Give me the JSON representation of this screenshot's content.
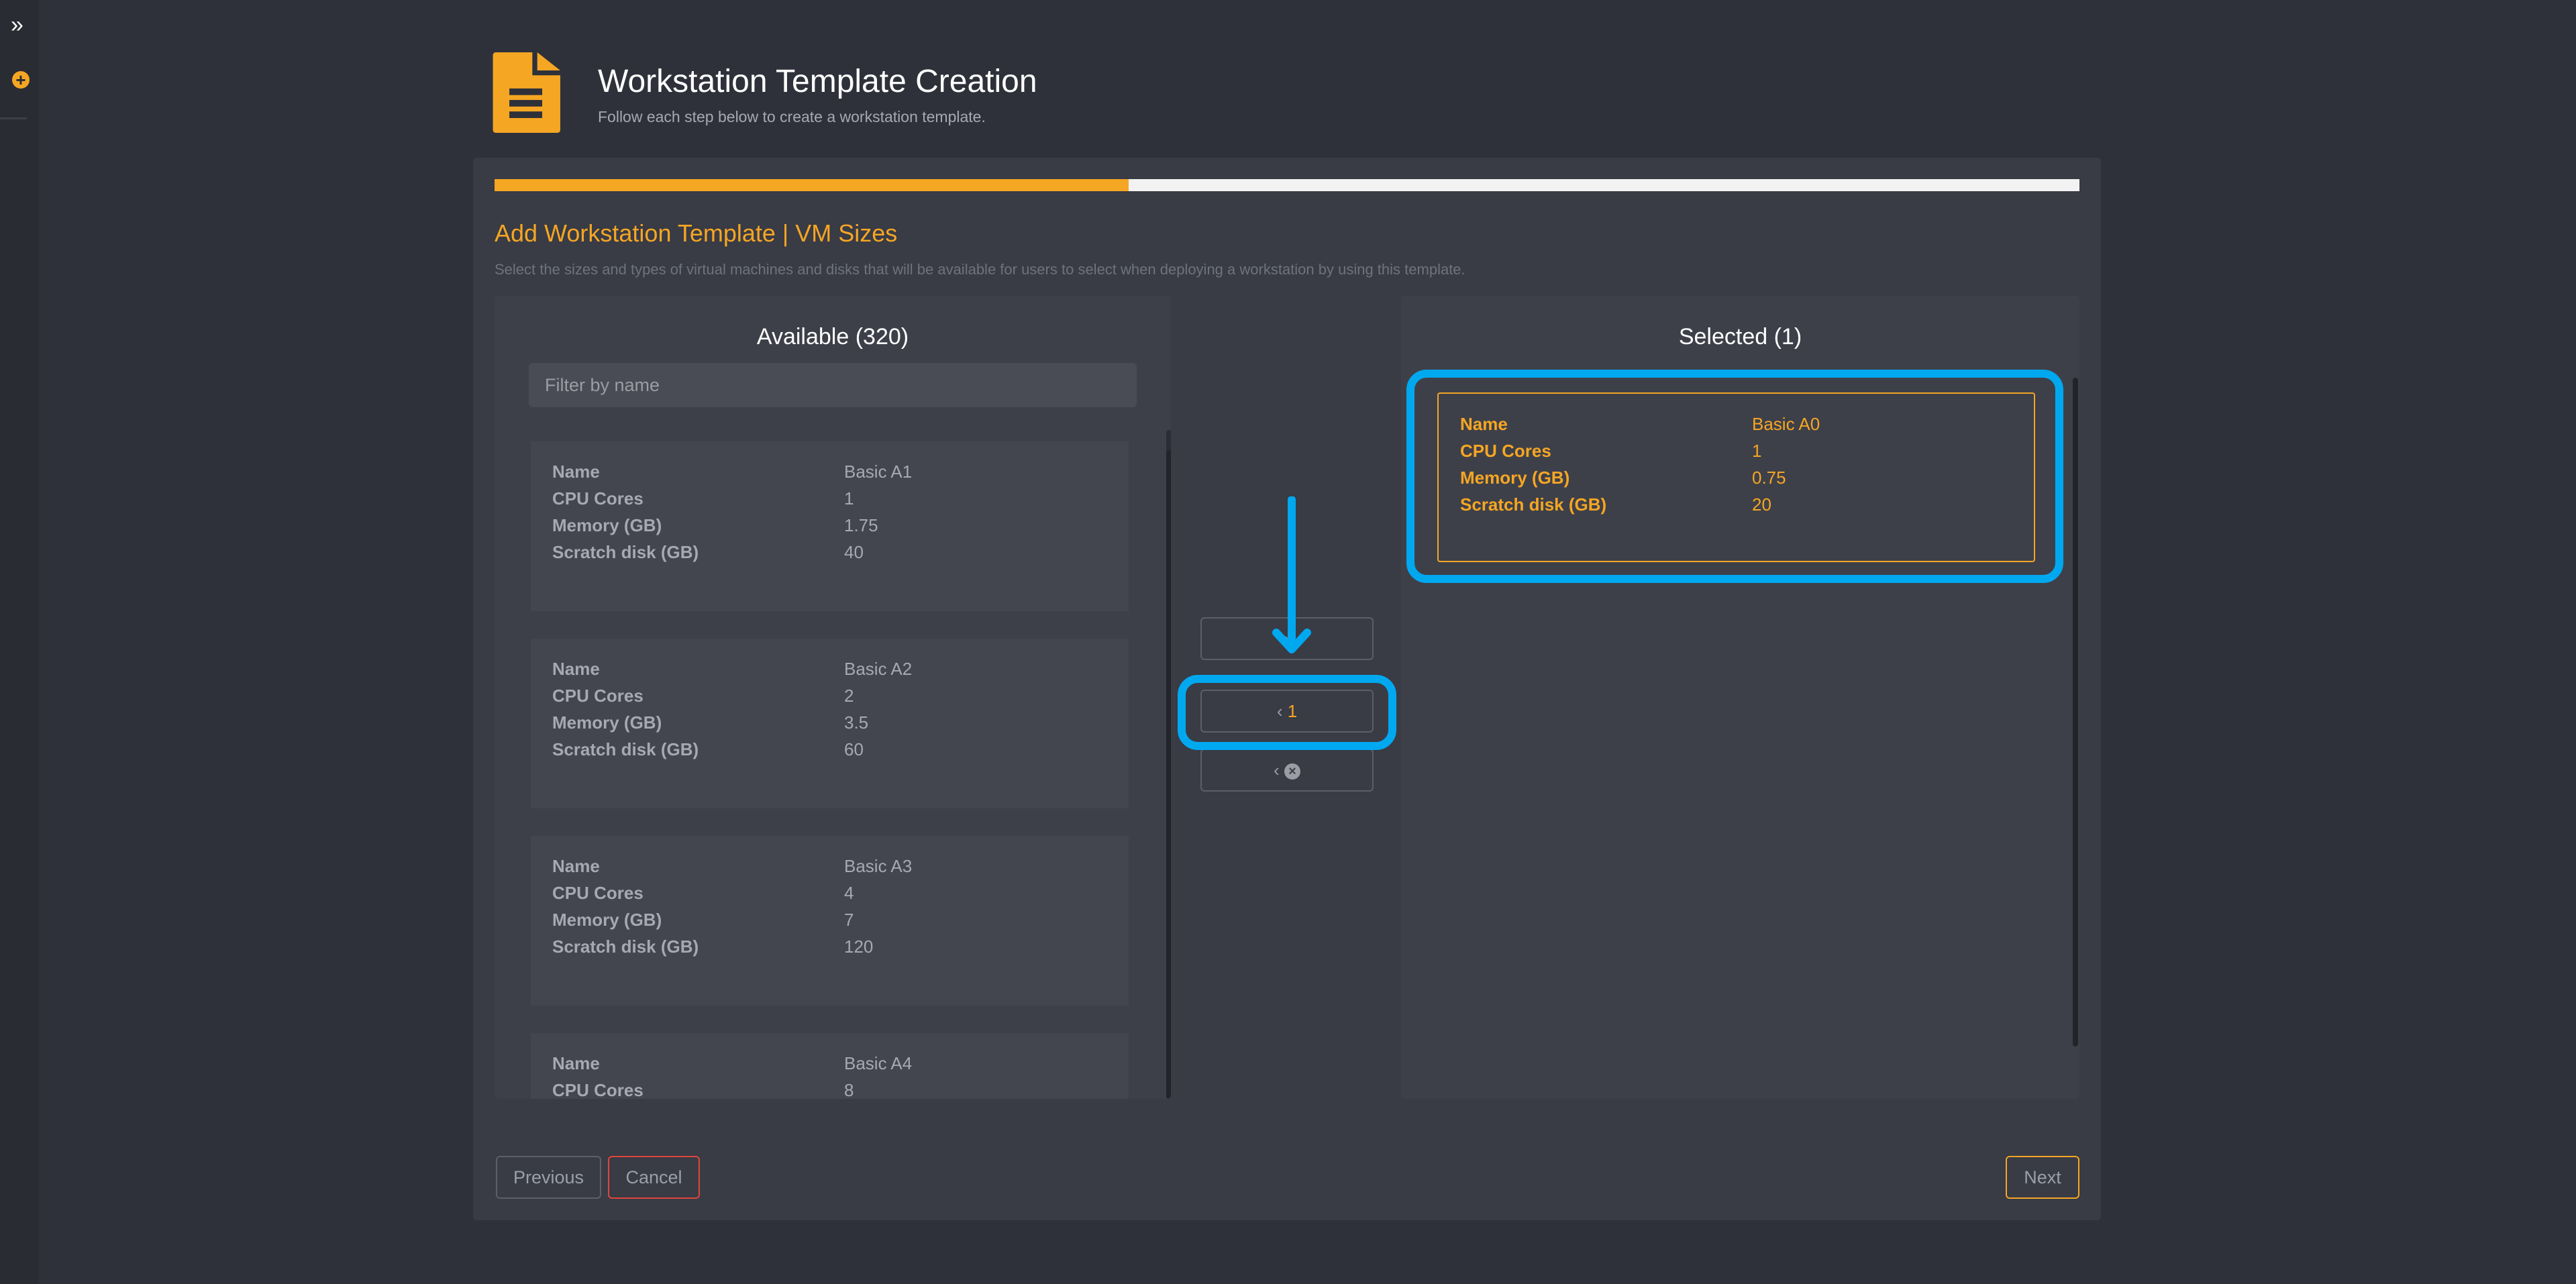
{
  "sidebar": {
    "expand_icon": "double-chevron-right-icon",
    "add_icon": "plus-circle-icon",
    "expand_glyph": "»",
    "add_glyph": "+"
  },
  "header": {
    "title": "Workstation Template Creation",
    "subtitle": "Follow each step below to create a workstation template.",
    "icon": "document-icon"
  },
  "progress": {
    "percent": 40
  },
  "step": {
    "title": "Add Workstation Template | VM Sizes",
    "description": "Select the sizes and types of virtual machines and disks that will be available for users to select when deploying a workstation by using this template."
  },
  "available": {
    "title": "Available (320)",
    "filter_placeholder": "Filter by name",
    "labels": [
      "Name",
      "CPU Cores",
      "Memory (GB)",
      "Scratch disk (GB)"
    ],
    "items": [
      {
        "name": "Basic A1",
        "cpu": "1",
        "memory": "1.75",
        "disk": "40"
      },
      {
        "name": "Basic A2",
        "cpu": "2",
        "memory": "3.5",
        "disk": "60"
      },
      {
        "name": "Basic A3",
        "cpu": "4",
        "memory": "7",
        "disk": "120"
      },
      {
        "name": "Basic A4",
        "cpu": "8",
        "memory": "",
        "disk": ""
      }
    ]
  },
  "selected": {
    "title": "Selected (1)",
    "items": [
      {
        "name": "Basic A0",
        "cpu": "1",
        "memory": "0.75",
        "disk": "20"
      }
    ]
  },
  "transfer": {
    "add_label": "›",
    "remove_chevron": "‹",
    "remove_count": "1",
    "remove_all_chevron": "‹",
    "remove_all_icon": "x-circle-icon"
  },
  "footer": {
    "previous": "Previous",
    "cancel": "Cancel",
    "next": "Next"
  },
  "colors": {
    "accent": "#f5a623",
    "highlight": "#00a8f0",
    "cancel": "#e0463c"
  }
}
